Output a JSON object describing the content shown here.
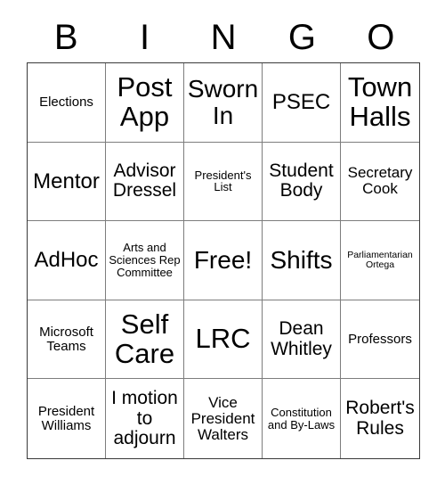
{
  "card": {
    "title_letters": [
      "B",
      "I",
      "N",
      "G",
      "O"
    ],
    "free_space_label": "Free!",
    "rows": [
      [
        {
          "text": "Elections",
          "size": "fs-xs"
        },
        {
          "text": "Post App",
          "size": "fs-xxl"
        },
        {
          "text": "Sworn In",
          "size": "fs-xl"
        },
        {
          "text": "PSEC",
          "size": "fs-lg"
        },
        {
          "text": "Town Halls",
          "size": "fs-xxl"
        }
      ],
      [
        {
          "text": "Mentor",
          "size": "fs-lg"
        },
        {
          "text": "Advisor Dressel",
          "size": "fs-md"
        },
        {
          "text": "President's List",
          "size": "fs-xxs"
        },
        {
          "text": "Student Body",
          "size": "fs-md"
        },
        {
          "text": "Secretary Cook",
          "size": "fs-sm"
        }
      ],
      [
        {
          "text": "AdHoc",
          "size": "fs-lg"
        },
        {
          "text": "Arts and Sciences Rep Committee",
          "size": "fs-xxs"
        },
        {
          "text": "Free!",
          "size": "fs-xl"
        },
        {
          "text": "Shifts",
          "size": "fs-xl"
        },
        {
          "text": "Parliamentarian Ortega",
          "size": "fs-tiny"
        }
      ],
      [
        {
          "text": "Microsoft Teams",
          "size": "fs-xs"
        },
        {
          "text": "Self Care",
          "size": "fs-xxl"
        },
        {
          "text": "LRC",
          "size": "fs-xxl"
        },
        {
          "text": "Dean Whitley",
          "size": "fs-md"
        },
        {
          "text": "Professors",
          "size": "fs-xs"
        }
      ],
      [
        {
          "text": "President Williams",
          "size": "fs-xs"
        },
        {
          "text": "I motion to adjourn",
          "size": "fs-md"
        },
        {
          "text": "Vice President Walters",
          "size": "fs-sm"
        },
        {
          "text": "Constitution and By-Laws",
          "size": "fs-xxs"
        },
        {
          "text": "Robert's Rules",
          "size": "fs-md"
        }
      ]
    ]
  },
  "colors": {
    "background": "#ffffff",
    "text": "#000000",
    "outer_border": "#3a3a3a",
    "inner_border": "#7d7d7d"
  }
}
